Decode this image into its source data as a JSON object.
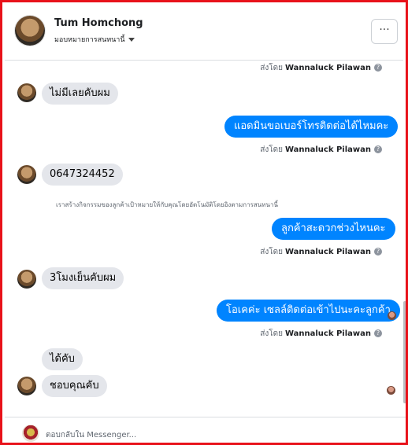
{
  "header": {
    "name": "Tum Homchong",
    "subtitle": "มอบหมายการสนทนานี้",
    "more_label": "···"
  },
  "messages": {
    "m1": {
      "meta_prefix": "ส่งโดย",
      "sender": "Wannaluck Pilawan"
    },
    "m2": {
      "text": "ไม่มีเลยคับผม"
    },
    "m3": {
      "text": "แอดมินขอเบอร์โทรติดต่อได้ไหมคะ",
      "meta_prefix": "ส่งโดย",
      "sender": "Wannaluck Pilawan"
    },
    "m4": {
      "text": "0647324452"
    },
    "note": "เราสร้างกิจกรรมของลูกค้าเป้าหมายให้กับคุณโดยอัตโนมัติโดยอิงตามการสนทนานี้",
    "m5": {
      "text": "ลูกค้าสะดวกช่วงไหนคะ",
      "meta_prefix": "ส่งโดย",
      "sender": "Wannaluck Pilawan"
    },
    "m6": {
      "text": "3โมงเย็นคับผม"
    },
    "m7": {
      "text": "โอเคค่ะ เซลล์ติดต่อเข้าไปนะคะลูกค้า",
      "meta_prefix": "ส่งโดย",
      "sender": "Wannaluck Pilawan"
    },
    "m8": {
      "text": "ได้คับ"
    },
    "m9": {
      "text": "ชอบคุณคับ"
    }
  },
  "footer": {
    "placeholder": "ตอบกลับใน Messenger..."
  },
  "colors": {
    "border": "#e8121a",
    "outgoing_bubble": "#0084ff",
    "incoming_bubble": "#e4e6eb"
  }
}
